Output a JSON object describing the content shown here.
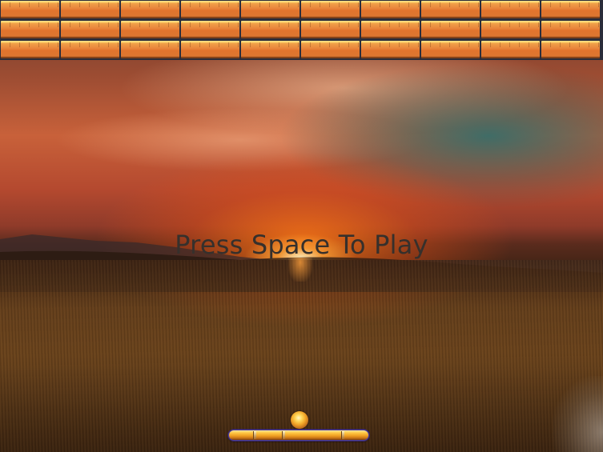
{
  "game": {
    "prompt_text": "Press Space To Play"
  },
  "bricks": {
    "rows": 3,
    "columns": 10,
    "color": "#e1742d",
    "highlight_color": "#ffd36a"
  },
  "ball": {
    "color": "#f0a326"
  },
  "paddle": {
    "color": "#f0a124",
    "outline_color": "#4a3fa0"
  },
  "background": {
    "scene": "sunset over wheat field"
  }
}
